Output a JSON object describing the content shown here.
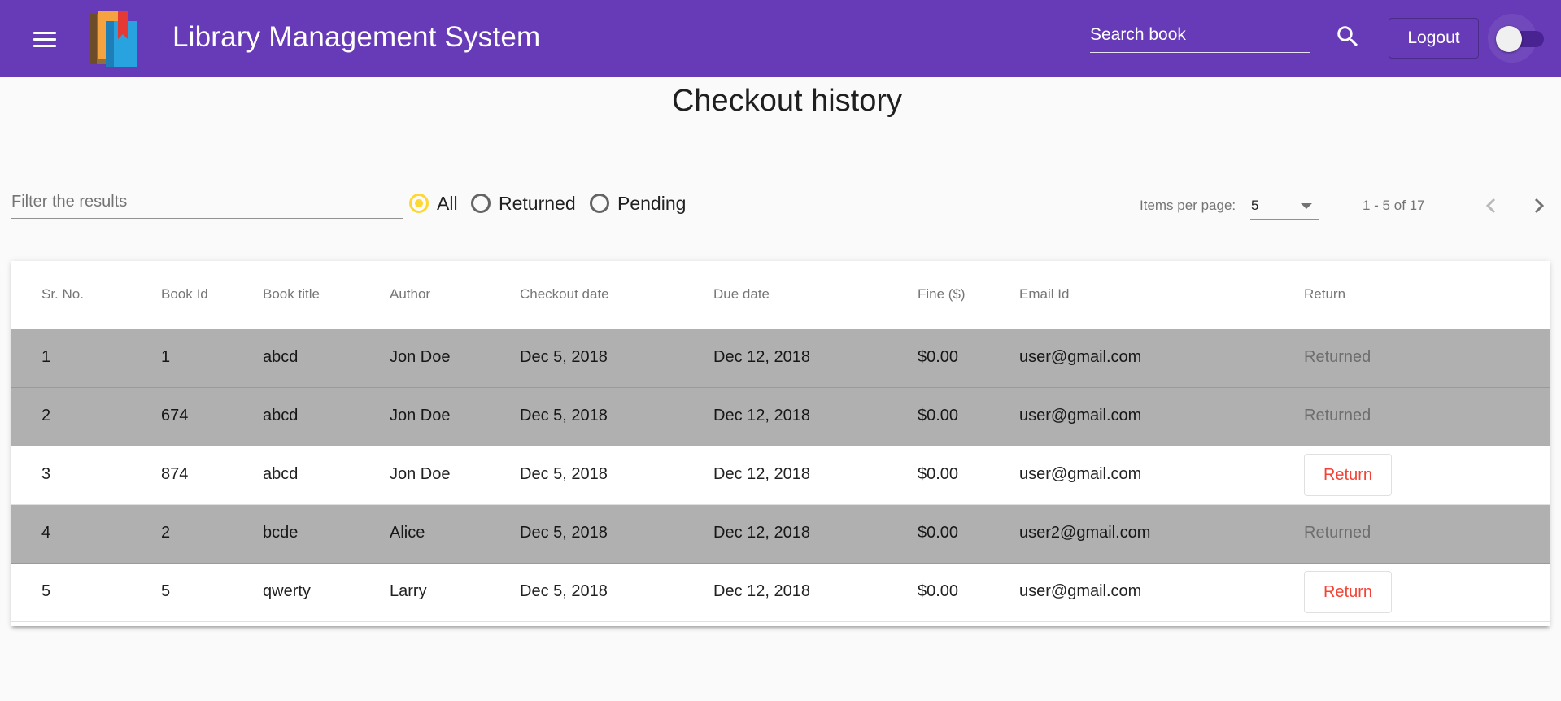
{
  "toolbar": {
    "title": "Library Management System",
    "search_placeholder": "Search book",
    "logout_label": "Logout"
  },
  "page": {
    "title": "Checkout history"
  },
  "filter": {
    "placeholder": "Filter the results",
    "options": [
      {
        "label": "All",
        "checked": true
      },
      {
        "label": "Returned",
        "checked": false
      },
      {
        "label": "Pending",
        "checked": false
      }
    ]
  },
  "paginator": {
    "items_label": "Items per page:",
    "page_size": "5",
    "range": "1 - 5 of 17"
  },
  "table": {
    "headers": [
      "Sr. No.",
      "Book Id",
      "Book title",
      "Author",
      "Checkout date",
      "Due date",
      "Fine ($)",
      "Email Id",
      "Return"
    ],
    "rows": [
      {
        "sr": "1",
        "book_id": "1",
        "title": "abcd",
        "author": "Jon Doe",
        "checkout": "Dec 5, 2018",
        "due": "Dec 12, 2018",
        "fine": "$0.00",
        "email": "user@gmail.com",
        "returned": true,
        "status": "Returned"
      },
      {
        "sr": "2",
        "book_id": "674",
        "title": "abcd",
        "author": "Jon Doe",
        "checkout": "Dec 5, 2018",
        "due": "Dec 12, 2018",
        "fine": "$0.00",
        "email": "user@gmail.com",
        "returned": true,
        "status": "Returned"
      },
      {
        "sr": "3",
        "book_id": "874",
        "title": "abcd",
        "author": "Jon Doe",
        "checkout": "Dec 5, 2018",
        "due": "Dec 12, 2018",
        "fine": "$0.00",
        "email": "user@gmail.com",
        "returned": false,
        "status": "Return"
      },
      {
        "sr": "4",
        "book_id": "2",
        "title": "bcde",
        "author": "Alice",
        "checkout": "Dec 5, 2018",
        "due": "Dec 12, 2018",
        "fine": "$0.00",
        "email": "user2@gmail.com",
        "returned": true,
        "status": "Returned"
      },
      {
        "sr": "5",
        "book_id": "5",
        "title": "qwerty",
        "author": "Larry",
        "checkout": "Dec 5, 2018",
        "due": "Dec 12, 2018",
        "fine": "$0.00",
        "email": "user@gmail.com",
        "returned": false,
        "status": "Return"
      }
    ]
  },
  "colors": {
    "primary": "#673ab7",
    "accent": "#fdd835",
    "warn": "#f44336",
    "returned_row": "#b0b0b0"
  },
  "icons": [
    "menu-icon",
    "books-logo",
    "search-icon",
    "chevron-left-icon",
    "chevron-right-icon",
    "dropdown-arrow-icon"
  ]
}
